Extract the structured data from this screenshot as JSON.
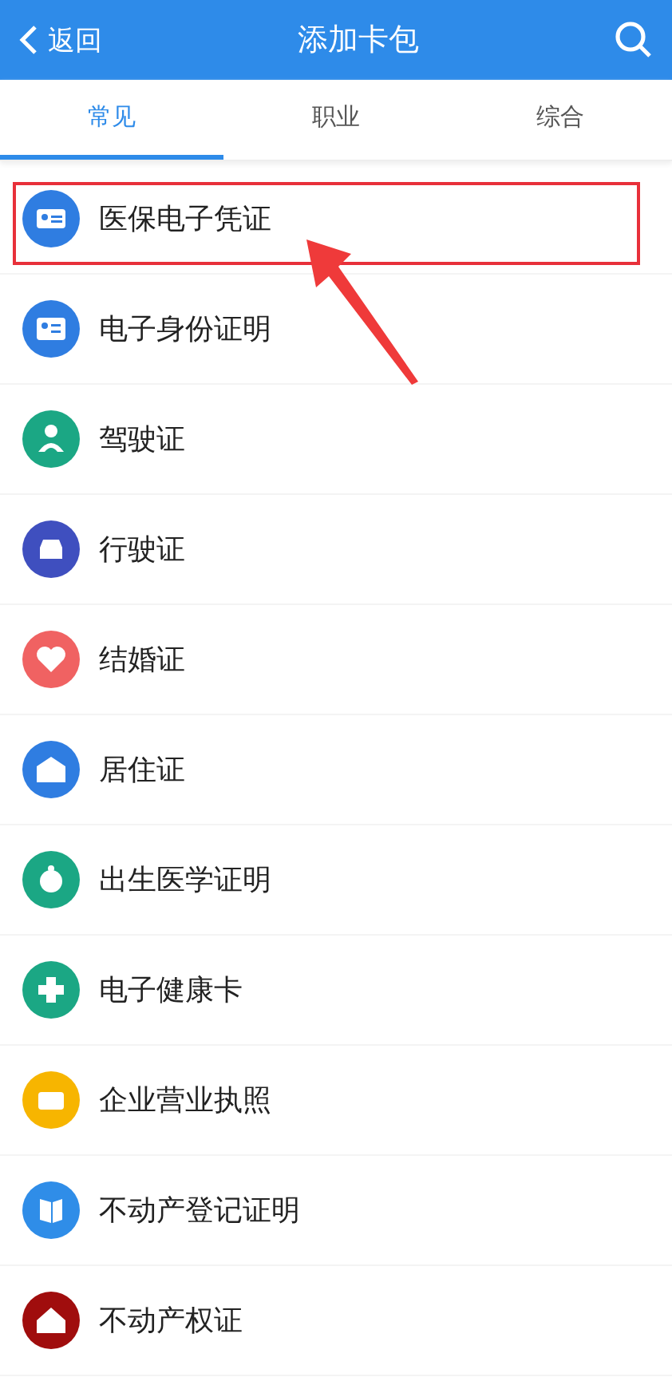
{
  "header": {
    "back_label": "返回",
    "title": "添加卡包"
  },
  "tabs": [
    {
      "label": "常见",
      "selected": true
    },
    {
      "label": "职业",
      "selected": false
    },
    {
      "label": "综合",
      "selected": false
    }
  ],
  "items": [
    {
      "label": "医保电子凭证",
      "color": "#2f7de1",
      "highlighted": true
    },
    {
      "label": "电子身份证明",
      "color": "#2f7de1",
      "highlighted": false
    },
    {
      "label": "驾驶证",
      "color": "#1ba784",
      "highlighted": false
    },
    {
      "label": "行驶证",
      "color": "#3f4fbf",
      "highlighted": false
    },
    {
      "label": "结婚证",
      "color": "#f06262",
      "highlighted": false
    },
    {
      "label": "居住证",
      "color": "#2f7de1",
      "highlighted": false
    },
    {
      "label": "出生医学证明",
      "color": "#1ba784",
      "highlighted": false
    },
    {
      "label": "电子健康卡",
      "color": "#1ba784",
      "highlighted": false
    },
    {
      "label": "企业营业执照",
      "color": "#f7b500",
      "highlighted": false
    },
    {
      "label": "不动产登记证明",
      "color": "#2f8de8",
      "highlighted": false
    },
    {
      "label": "不动产权证",
      "color": "#a00d0d",
      "highlighted": false
    }
  ]
}
